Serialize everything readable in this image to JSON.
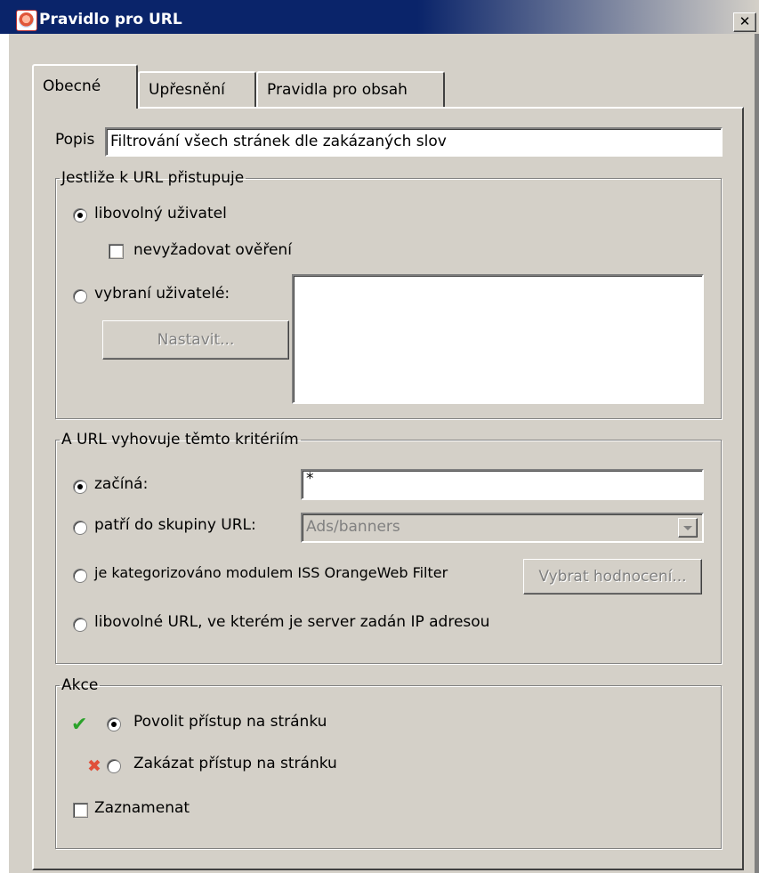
{
  "window": {
    "title": "Pravidlo pro URL",
    "close_glyph": "✕"
  },
  "tabs": [
    {
      "label": "Obecné",
      "active": true
    },
    {
      "label": "Upřesnění",
      "active": false
    },
    {
      "label": "Pravidla pro obsah",
      "active": false
    }
  ],
  "description": {
    "label": "Popis",
    "value": "Filtrování všech stránek dle zakázaných slov"
  },
  "access_group": {
    "legend": "Jestliže k URL přistupuje",
    "any_user": {
      "label": "libovolný uživatel",
      "checked": true
    },
    "no_auth": {
      "label": "nevyžadovat ověření",
      "checked": false
    },
    "selected_users": {
      "label": "vybraní uživatelé:",
      "checked": false
    },
    "set_button": "Nastavit..."
  },
  "criteria_group": {
    "legend": "A URL vyhovuje těmto kritériím",
    "starts_with": {
      "label": "začíná:",
      "checked": true,
      "value": "*"
    },
    "url_group": {
      "label": "patří do skupiny URL:",
      "checked": false,
      "selected": "Ads/banners"
    },
    "iss": {
      "label": "je kategorizováno modulem ISS OrangeWeb Filter",
      "checked": false,
      "button": "Vybrat hodnocení..."
    },
    "ip": {
      "label": "libovolné URL, ve kterém je server zadán IP adresou",
      "checked": false
    }
  },
  "action_group": {
    "legend": "Akce",
    "allow": {
      "label": "Povolit přístup na stránku",
      "checked": true,
      "icon_glyph": "✔"
    },
    "deny": {
      "label": "Zakázat přístup na stránku",
      "checked": false,
      "icon_glyph": "✖"
    },
    "log": {
      "label": "Zaznamenat",
      "checked": false
    }
  },
  "colors": {
    "titlebar": "#0a246a",
    "window_bg": "#d4d0c8",
    "allow_icon": "#2aa22a",
    "deny_icon": "#e0503a"
  }
}
